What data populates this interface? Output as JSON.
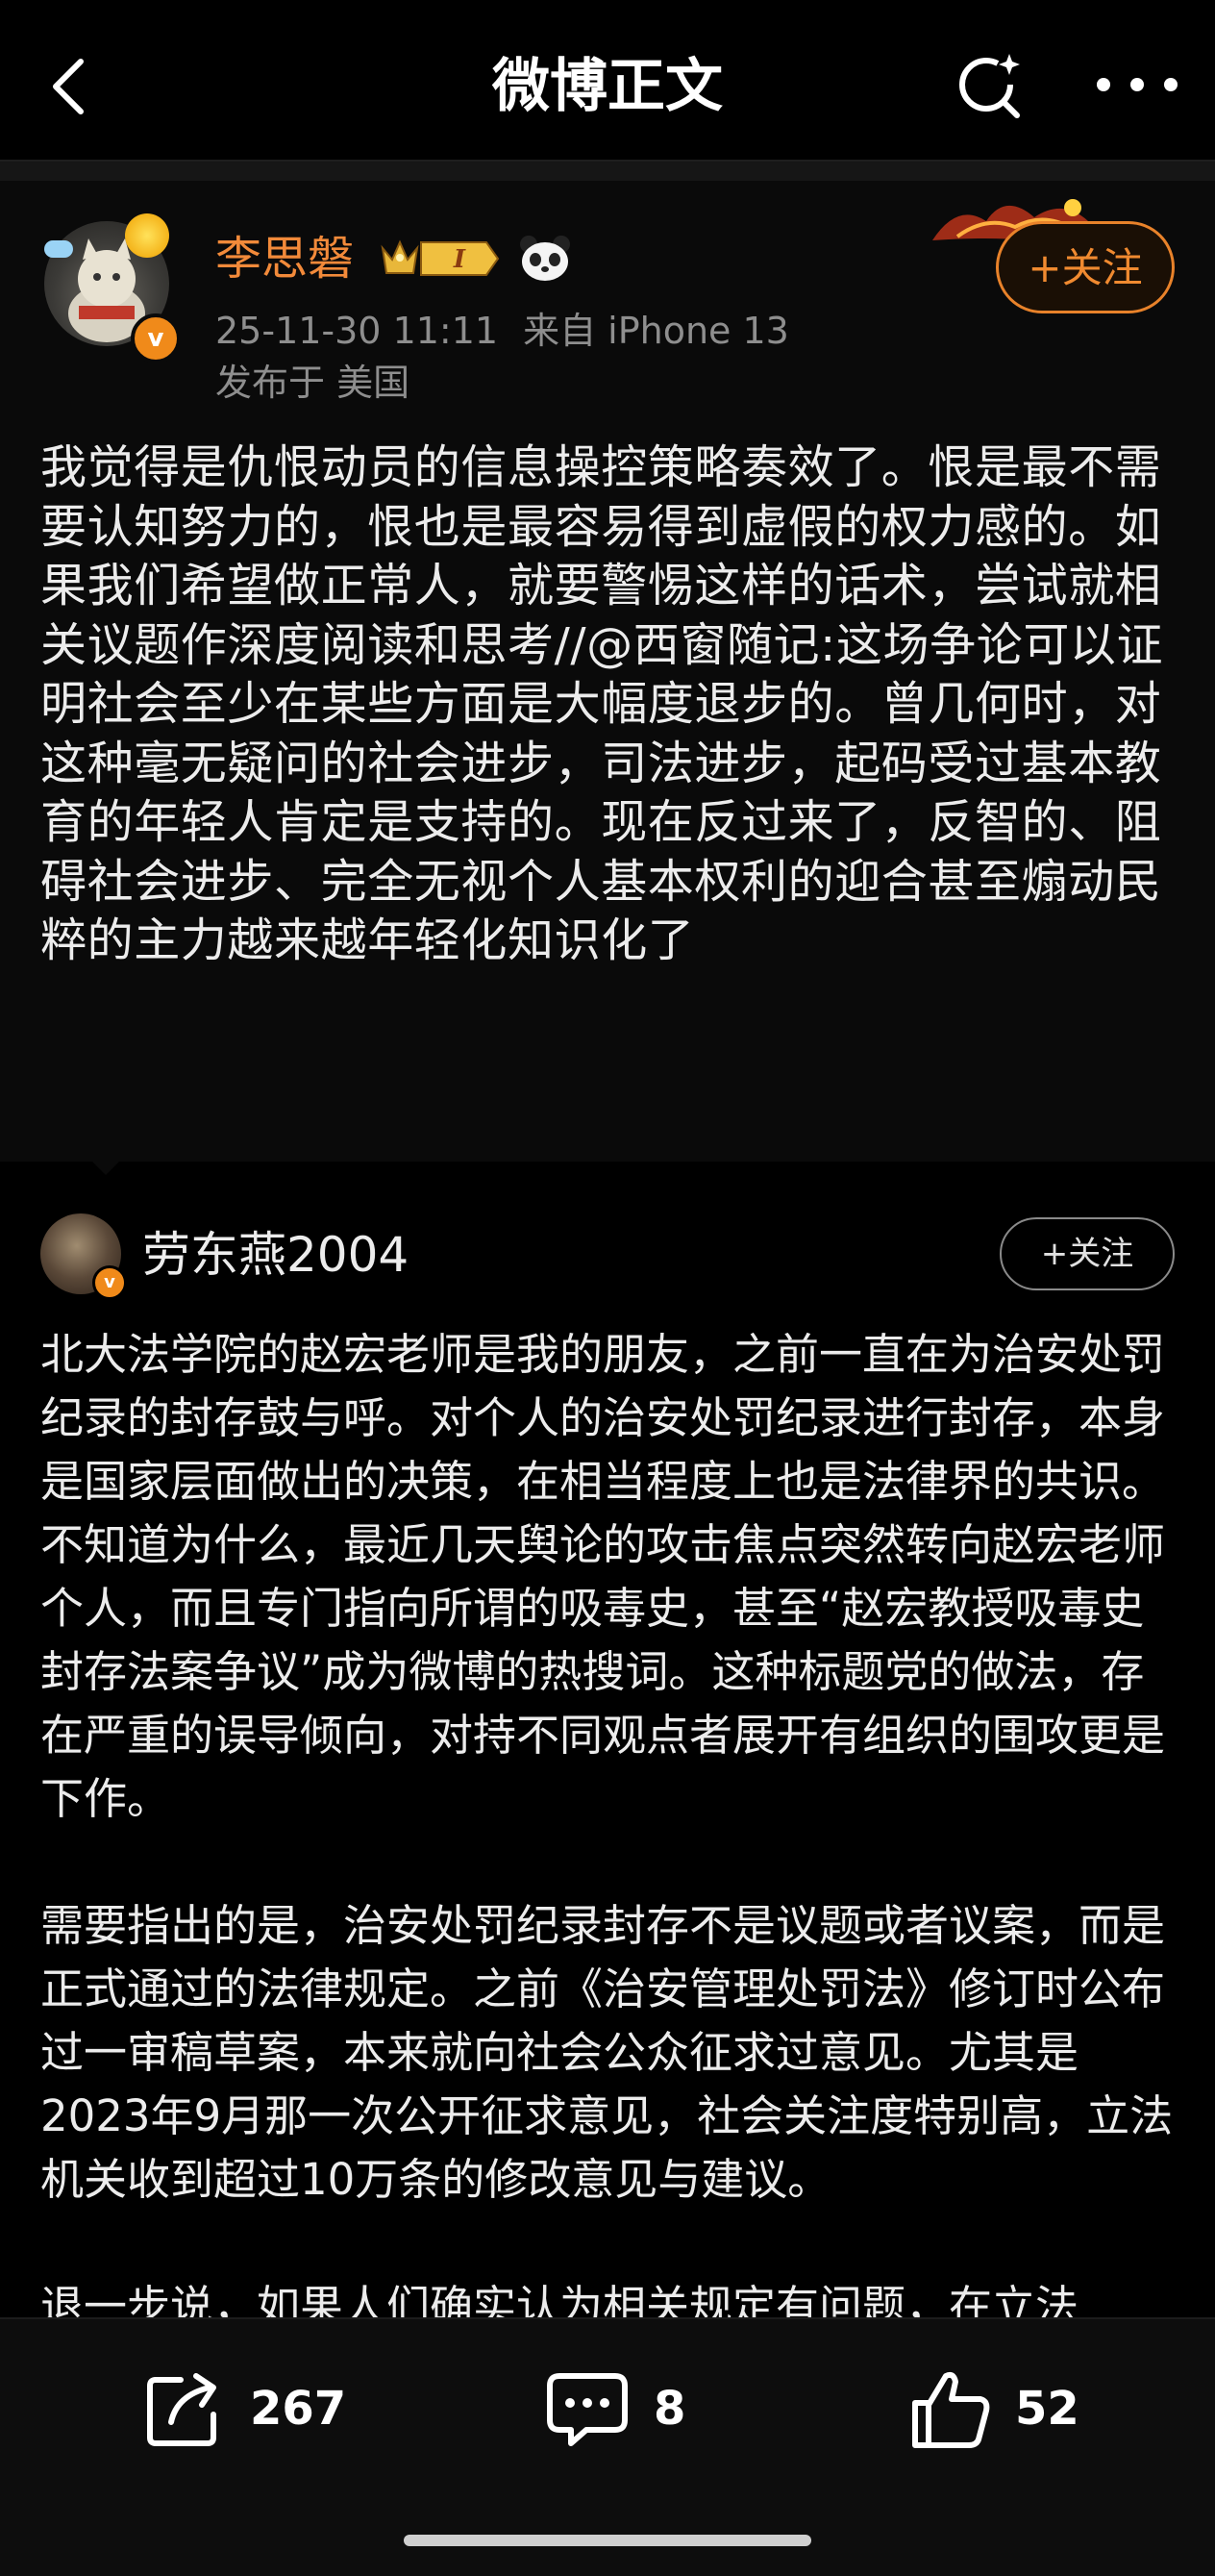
{
  "header": {
    "title": "微博正文"
  },
  "original_post": {
    "author": "李思磐",
    "vip_badge_text": "I",
    "timestamp": "25-11-30 11:11",
    "source": "来自 iPhone 13",
    "location": "发布于 美国",
    "follow_label": "+关注",
    "text": "我觉得是仇恨动员的信息操控策略奏效了。恨是最不需要认知努力的，恨也是最容易得到虚假的权力感的。如果我们希望做正常人，就要警惕这样的话术，尝试就相关议题作深度阅读和思考//@西窗随记:这场争论可以证明社会至少在某些方面是大幅度退步的。曾几何时，对这种毫无疑问的社会进步，司法进步，起码受过基本教育的年轻人肯定是支持的。现在反过来了，反智的、阻碍社会进步、完全无视个人基本权利的迎合甚至煽动民粹的主力越来越年轻化知识化了"
  },
  "repost": {
    "author": "劳东燕2004",
    "follow_label": "+关注",
    "paragraphs": [
      "北大法学院的赵宏老师是我的朋友，之前一直在为治安处罚纪录的封存鼓与呼。对个人的治安处罚纪录进行封存，本身是国家层面做出的决策，在相当程度上也是法律界的共识。不知道为什么，最近几天舆论的攻击焦点突然转向赵宏老师个人，而且专门指向所谓的吸毒史，甚至“赵宏教授吸毒史封存法案争议”成为微博的热搜词。这种标题党的做法，存在严重的误导倾向，对持不同观点者展开有组织的围攻更是下作。",
      "需要指出的是，治安处罚纪录封存不是议题或者议案，而是正式通过的法律规定。之前《治安管理处罚法》修订时公布过一审稿草案，本来就向社会公众征求过意见。尤其是2023年9月那一次公开征求意见，社会关注度特别高，立法机关收到超过10万条的修改意见与建议。",
      "退一步说，如果人们确实认为相关规定有问题，在立法"
    ]
  },
  "actions": {
    "share_count": "267",
    "comment_count": "8",
    "like_count": "52"
  },
  "colors": {
    "accent": "#f08a30",
    "background": "#000000",
    "text": "#ececec",
    "meta": "#8e8e8e"
  }
}
